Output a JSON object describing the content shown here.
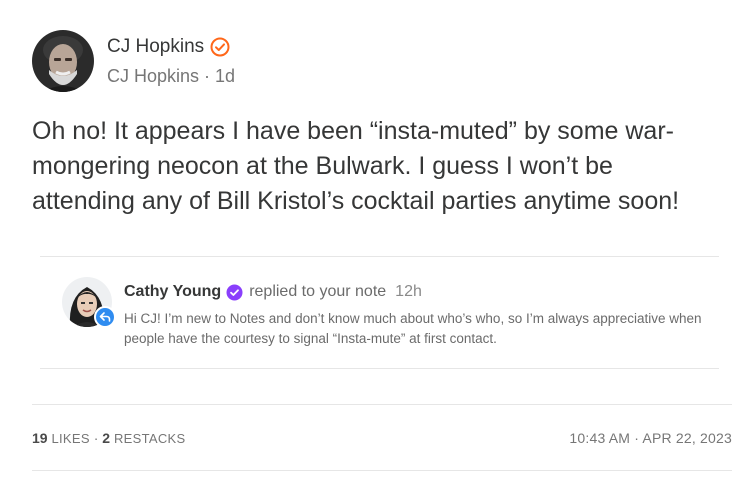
{
  "note": {
    "author_name": "CJ Hopkins",
    "handle": "CJ Hopkins",
    "age": "1d",
    "body": "Oh no! It appears I have been “insta-muted” by some war-mongering neocon at the Bulwark. I guess I won’t be attending any of Bill Kristol’s cocktail parties anytime soon!"
  },
  "embed": {
    "author": "Cathy Young",
    "action": "replied to your note",
    "time": "12h",
    "text": "Hi CJ! I’m new to Notes and don’t know much about who’s who, so I’m always appreciative when people have the courtesy to signal “Insta-mute” at first contact."
  },
  "stats": {
    "likes_count": "19",
    "likes_label": "LIKES",
    "restacks_count": "2",
    "restacks_label": "RESTACKS",
    "separator": "·",
    "timestamp": "10:43 AM · APR 22, 2023"
  },
  "colors": {
    "verified_orange": "#ff6719",
    "verified_purple": "#8a3ffc",
    "reply_badge_blue": "#2f8cf0"
  },
  "icons": {
    "author_verified": "orange-check-badge-icon",
    "embed_verified": "purple-check-badge-icon",
    "reply_badge": "reply-arrow-icon"
  }
}
